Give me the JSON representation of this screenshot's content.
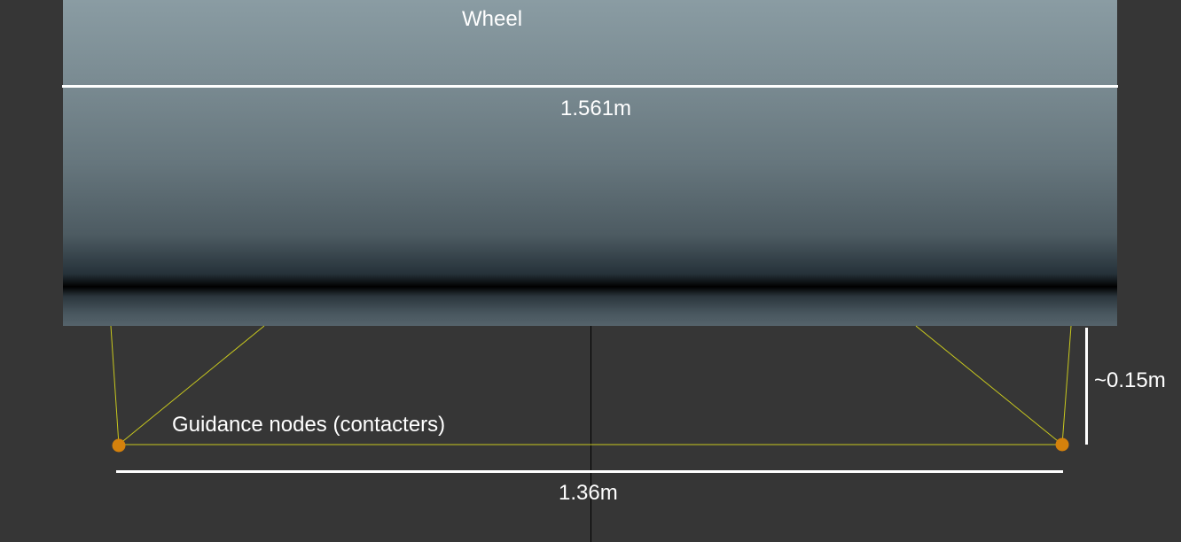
{
  "wheel": {
    "title": "Wheel",
    "width_label": "1.561m"
  },
  "guidance": {
    "label": "Guidance nodes (contacters)",
    "node_color": "#d4810c",
    "link_color": "#c8c81e"
  },
  "dimensions": {
    "node_span_label": "1.36m",
    "node_offset_label": "~0.15m"
  },
  "colors": {
    "background": "#363636",
    "dimension_line": "#ffffff",
    "center_line": "#000000"
  }
}
